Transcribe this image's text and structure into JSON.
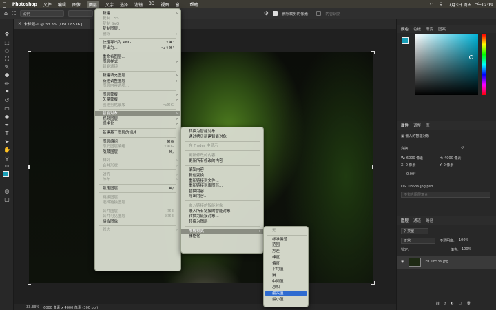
{
  "macbar": {
    "app": "Photoshop",
    "menus": [
      "文件",
      "编辑",
      "图像",
      "图层",
      "文字",
      "选择",
      "滤镜",
      "3D",
      "视图",
      "窗口",
      "帮助"
    ],
    "active_menu": "图层",
    "clock": "7月3日 周五 上午12:19"
  },
  "options": {
    "ratio": "比例",
    "delete_cropped": "删除裁剪的像素",
    "content_aware": "内容识别"
  },
  "document": {
    "tab_title": "未标题-1 @ 33.3% (DSC08536.j..."
  },
  "status": {
    "zoom": "33.33%",
    "size": "6000 像素 x 4000 像素 (300 ppi)"
  },
  "layer_menu": [
    {
      "label": "新建",
      "submenu": true
    },
    {
      "label": "复制 CSS",
      "disabled": true
    },
    {
      "label": "复制 SVG",
      "disabled": true
    },
    {
      "label": "复制图层..."
    },
    {
      "label": "删除",
      "disabled": true,
      "submenu": true
    },
    {
      "sep": true
    },
    {
      "label": "快速导出为 PNG",
      "shortcut": "⇧⌘'"
    },
    {
      "label": "导出为...",
      "shortcut": "⌥⇧⌘'"
    },
    {
      "sep": true
    },
    {
      "label": "重命名图层..."
    },
    {
      "label": "图层样式",
      "submenu": true
    },
    {
      "label": "智能滤镜",
      "disabled": true
    },
    {
      "sep": true
    },
    {
      "label": "新建填充图层",
      "submenu": true
    },
    {
      "label": "新建调整图层",
      "submenu": true
    },
    {
      "label": "图层内容选项...",
      "disabled": true
    },
    {
      "sep": true
    },
    {
      "label": "图层蒙版",
      "submenu": true
    },
    {
      "label": "矢量蒙版",
      "submenu": true
    },
    {
      "label": "创建剪贴蒙版",
      "shortcut": "⌥⌘G",
      "disabled": true
    },
    {
      "sep": true
    },
    {
      "label": "智能对象",
      "submenu": true,
      "highlight": true
    },
    {
      "label": "视频图层",
      "submenu": true
    },
    {
      "label": "栅格化",
      "submenu": true
    },
    {
      "sep": true
    },
    {
      "label": "新建基于图层的切片"
    },
    {
      "sep": true
    },
    {
      "label": "图层编组",
      "shortcut": "⌘G"
    },
    {
      "label": "取消图层编组",
      "shortcut": "⇧⌘G",
      "disabled": true
    },
    {
      "label": "隐藏图层",
      "shortcut": "⌘,"
    },
    {
      "sep": true
    },
    {
      "label": "排列",
      "submenu": true,
      "disabled": true
    },
    {
      "label": "合并形状",
      "submenu": true,
      "disabled": true
    },
    {
      "sep": true
    },
    {
      "label": "对齐",
      "submenu": true,
      "disabled": true
    },
    {
      "label": "分布",
      "submenu": true,
      "disabled": true
    },
    {
      "sep": true
    },
    {
      "label": "锁定图层...",
      "shortcut": "⌘/"
    },
    {
      "sep": true
    },
    {
      "label": "链接图层",
      "disabled": true
    },
    {
      "label": "选择链接图层",
      "disabled": true
    },
    {
      "sep": true
    },
    {
      "label": "合并图层",
      "shortcut": "⌘E",
      "disabled": true
    },
    {
      "label": "合并可见图层",
      "shortcut": "⇧⌘E",
      "disabled": true
    },
    {
      "label": "拼合图像"
    },
    {
      "sep": true
    },
    {
      "label": "修边",
      "submenu": true,
      "disabled": true
    }
  ],
  "smart_menu": [
    {
      "label": "转换为智能对象"
    },
    {
      "label": "通过拷贝新建智能对象"
    },
    {
      "sep": true
    },
    {
      "label": "在 Finder 中显示",
      "disabled": true
    },
    {
      "sep": true
    },
    {
      "label": "更新修改的内容",
      "disabled": true
    },
    {
      "label": "更新所有修改的内容"
    },
    {
      "sep": true
    },
    {
      "label": "编辑内容"
    },
    {
      "label": "复位变换"
    },
    {
      "label": "重新链接到文件..."
    },
    {
      "label": "重新链接到库图形..."
    },
    {
      "label": "替换内容..."
    },
    {
      "label": "导出内容..."
    },
    {
      "sep": true
    },
    {
      "label": "嵌入链接的智能对象",
      "disabled": true
    },
    {
      "label": "嵌入所有链接的智能对象"
    },
    {
      "label": "转换为链接对象..."
    },
    {
      "label": "转换为图层"
    },
    {
      "sep": true
    },
    {
      "label": "堆栈模式",
      "submenu": true,
      "highlight": true
    },
    {
      "label": "栅格化"
    }
  ],
  "stack_menu": [
    {
      "label": "无",
      "disabled": true
    },
    {
      "sep": true
    },
    {
      "label": "标准偏差"
    },
    {
      "label": "范围"
    },
    {
      "label": "方差"
    },
    {
      "label": "峰度"
    },
    {
      "label": "偏度"
    },
    {
      "label": "平均值"
    },
    {
      "label": "熵"
    },
    {
      "label": "中间值"
    },
    {
      "label": "总和"
    },
    {
      "label": "最大值",
      "selected": true
    },
    {
      "label": "最小值"
    }
  ],
  "panels": {
    "color_tabs": [
      "颜色",
      "色板",
      "渐变",
      "图案"
    ],
    "prop_tabs": [
      "属性",
      "调整",
      "库"
    ],
    "prop_type": "嵌入的智能对象",
    "transform_label": "变换",
    "w": "W: 6000 像素",
    "h": "H: 4000 像素",
    "x": "X: 0 像素",
    "y": "Y: 0 像素",
    "angle": "0.00°",
    "filename": "DSC08536.jpg.psb",
    "no_comps": "不包含图层复合",
    "layer_tabs": [
      "图层",
      "通道",
      "路径"
    ],
    "kind": "类型",
    "blend": "正常",
    "opacity_label": "不透明度:",
    "opacity": "100%",
    "lock_label": "锁定:",
    "fill_label": "填充:",
    "fill": "100%",
    "layer_name": "DSC08536.jpg"
  },
  "accent": "#2e6bd0",
  "fg_color": "#1a9fb8"
}
